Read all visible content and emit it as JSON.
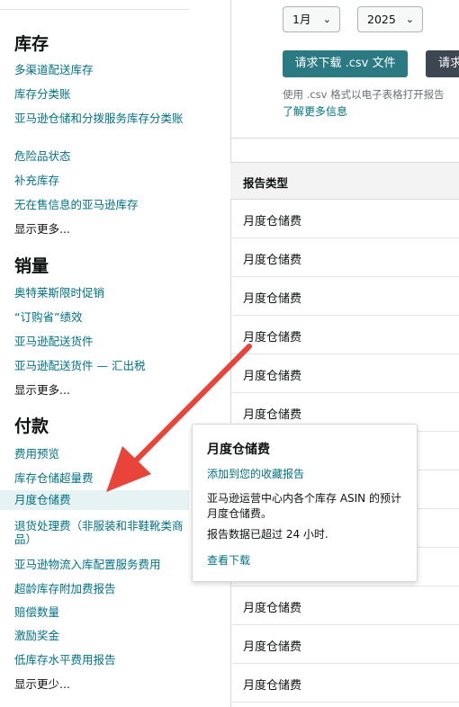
{
  "sidebar": {
    "inventory": {
      "title": "库存",
      "items": [
        "多渠道配送库存",
        "库存分类账",
        "亚马逊仓储和分拨服务库存分类账",
        "危险品状态",
        "补充库存",
        "无在售信息的亚马逊库存"
      ],
      "show_more": "显示更多..."
    },
    "sales": {
      "title": "销量",
      "items": [
        "奥特莱斯限时促销",
        "“订购省”绩效",
        "亚马逊配送货件",
        "亚马逊配送货件 — 汇出税"
      ],
      "show_more": "显示更多..."
    },
    "payments": {
      "title": "付款",
      "items": [
        "费用预览",
        "库存仓储超量费",
        "月度仓储费",
        "退货处理费（非服装和非鞋靴类商品）",
        "亚马逊物流入库配置服务费用",
        "超龄库存附加费报告",
        "赔偿数量",
        "激励奖金",
        "低库存水平费用报告"
      ],
      "active_index": 2,
      "show_less": "显示更少..."
    }
  },
  "main": {
    "month_select": "1月",
    "year_select": "2025",
    "download_csv_button": "请求下载 .csv 文件",
    "second_button": "请求",
    "csv_note": "使用 .csv 格式以电子表格打开报告",
    "learn_more": "了解更多信息",
    "table": {
      "header": "报告类型",
      "rows": [
        "月度仓储费",
        "月度仓储费",
        "月度仓储费",
        "月度仓储费",
        "月度仓储费",
        "月度仓储费",
        "",
        "",
        "",
        "",
        "月度仓储费",
        "月度仓储费",
        "月度仓储费",
        "月度仓储费"
      ]
    }
  },
  "popover": {
    "title": "月度仓储费",
    "add_favorite": "添加到您的收藏报告",
    "description": "亚马逊运营中心内各个库存 ASIN 的预计月度仓储费。",
    "data_age": "报告数据已超过 24 小时.",
    "view_download": "查看下载"
  },
  "colors": {
    "link": "#007185",
    "primary_button": "#2b7a83",
    "active_row": "#e6f2f3",
    "arrow": "#e8443a"
  },
  "icons": {
    "select_chevron": "chevron-down-icon",
    "annotation": "red-arrow-annotation"
  }
}
